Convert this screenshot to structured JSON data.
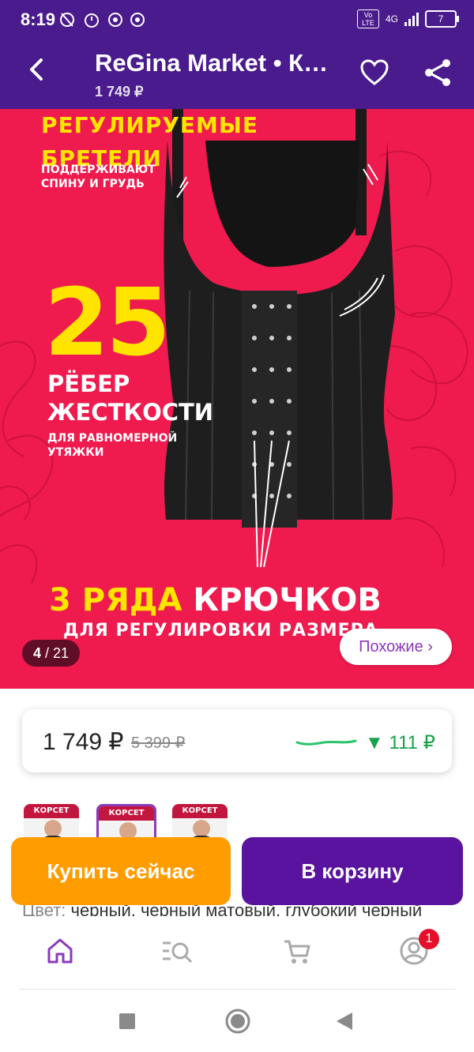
{
  "status_bar": {
    "time": "8:19",
    "network": "4G",
    "volte": "Vo LTE",
    "battery": "7"
  },
  "app_bar": {
    "title": "ReGina Market • Корсет",
    "price": "1 749 ₽"
  },
  "gallery": {
    "headline": "РЕГУЛИРУЕМЫЕ\nБРЕТЕЛИ",
    "headline_sub": "ПОДДЕРЖИВАЮТ\nСПИНУ И ГРУДЬ",
    "ribs_number": "25",
    "ribs_text": "РЁБЕР\nЖЕСТКОСТИ",
    "ribs_sub": "ДЛЯ РАВНОМЕРНОЙ\nУТЯЖКИ",
    "rows_yellow": "3 РЯДА",
    "rows_white": "КРЮЧКОВ",
    "rows_sub": "ДЛЯ РЕГУЛИРОВКИ РАЗМЕРА",
    "counter_current": "4",
    "counter_total": "/ 21",
    "similar_label": "Похожие ›"
  },
  "price_card": {
    "price": "1 749 ₽",
    "old_price": "5 399 ₽",
    "drop": "▼ 111 ₽"
  },
  "thumbnails": [
    {
      "label": "КОРСЕТ"
    },
    {
      "label": "КОРСЕТ"
    },
    {
      "label": "КОРСЕТ"
    }
  ],
  "actions": {
    "buy_now": "Купить сейчас",
    "add_to_cart": "В корзину"
  },
  "color_line": {
    "label": "Цвет:",
    "value": "черный, черный матовый, глубокий черный"
  },
  "bottom_nav": {
    "profile_badge": "1"
  },
  "colors": {
    "brand_purple": "#4a1b8c",
    "hero_red": "#ef1a4d",
    "buy_orange": "#ff9c00",
    "cart_purple": "#5a139f",
    "price_green": "#1aa14a"
  }
}
